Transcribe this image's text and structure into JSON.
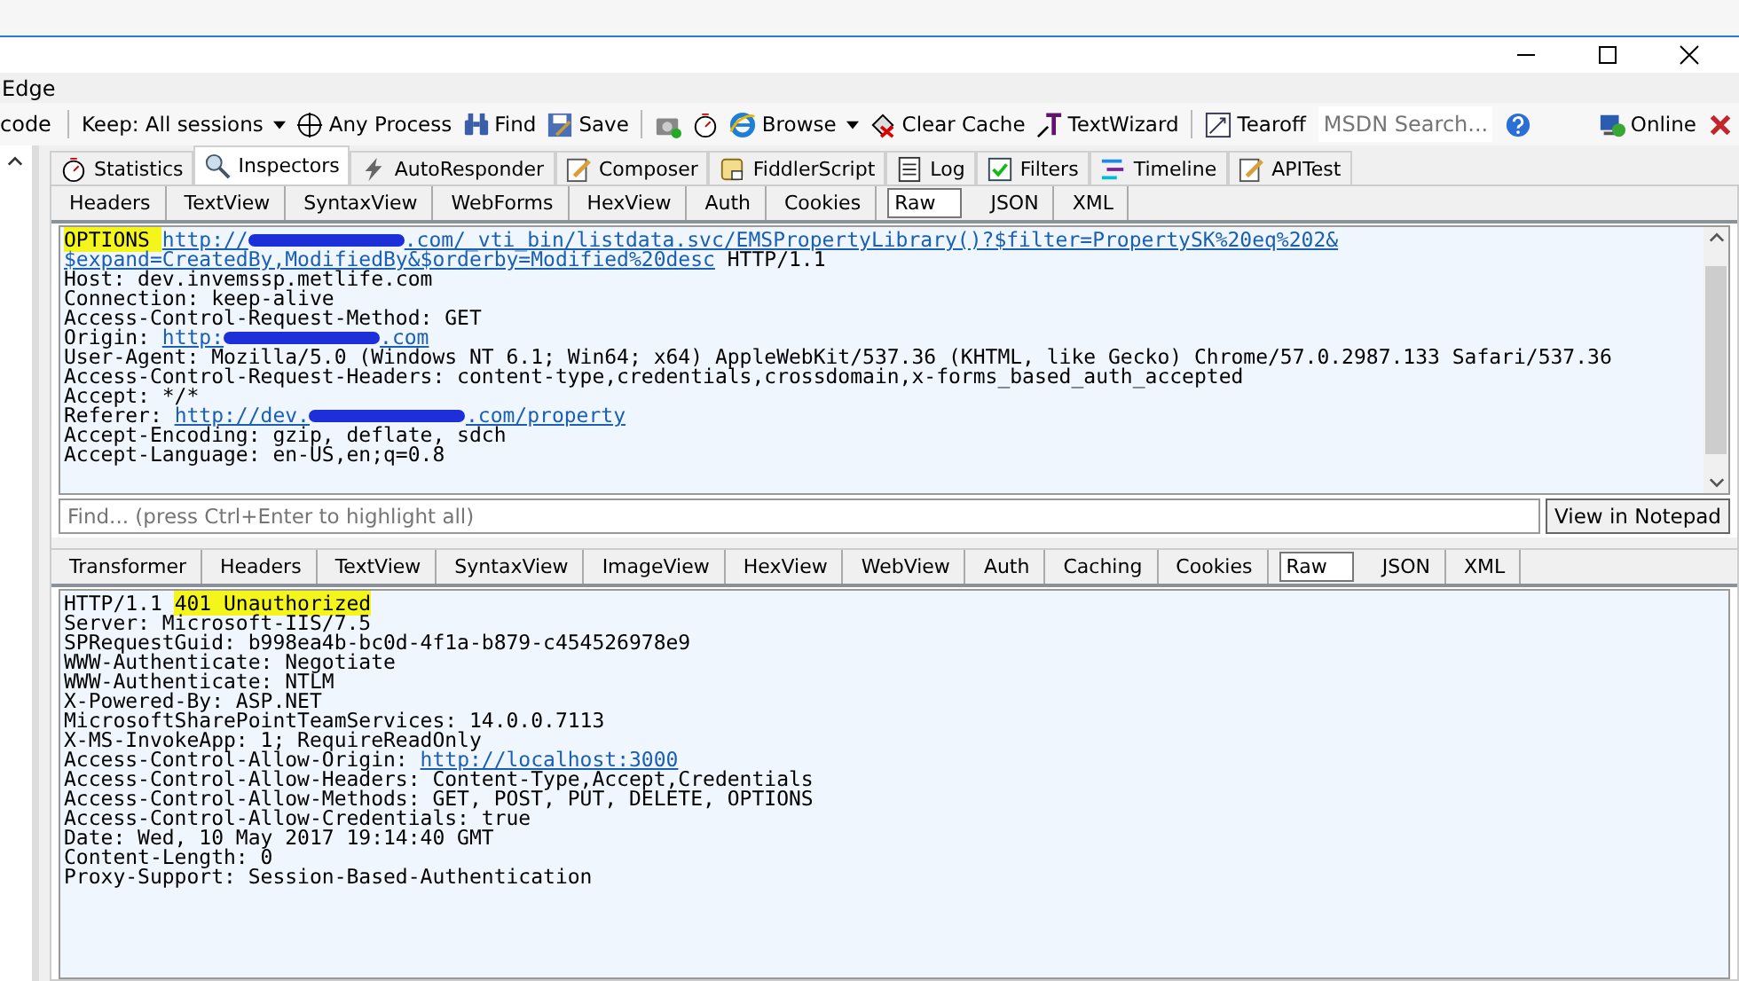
{
  "menu": {
    "items": [
      "Edge"
    ]
  },
  "toolbar": {
    "items": [
      {
        "kind": "text",
        "label": "code"
      },
      {
        "kind": "separator"
      },
      {
        "kind": "dropdown",
        "label": "Keep: All sessions"
      },
      {
        "kind": "button",
        "label": "Any Process"
      },
      {
        "kind": "button",
        "label": "Find"
      },
      {
        "kind": "button",
        "label": "Save"
      },
      {
        "kind": "separator"
      },
      {
        "kind": "button"
      },
      {
        "kind": "button"
      },
      {
        "kind": "dropdown",
        "label": "Browse"
      },
      {
        "kind": "button",
        "label": "Clear Cache"
      },
      {
        "kind": "button",
        "label": "TextWizard"
      },
      {
        "kind": "separator"
      },
      {
        "kind": "button",
        "label": "Tearoff"
      },
      {
        "kind": "search",
        "placeholder": "MSDN Search..."
      },
      {
        "kind": "button"
      },
      {
        "kind": "spacer"
      },
      {
        "kind": "button",
        "label": "Online"
      },
      {
        "kind": "button"
      }
    ]
  },
  "main_tabs": [
    {
      "label": "Statistics",
      "selected": false
    },
    {
      "label": "Inspectors",
      "selected": true
    },
    {
      "label": "AutoResponder",
      "selected": false
    },
    {
      "label": "Composer",
      "selected": false
    },
    {
      "label": "FiddlerScript",
      "selected": false
    },
    {
      "label": "Log",
      "selected": false
    },
    {
      "label": "Filters",
      "selected": false
    },
    {
      "label": "Timeline",
      "selected": false
    },
    {
      "label": "APITest",
      "selected": false
    }
  ],
  "request": {
    "tabs": [
      {
        "label": "Headers",
        "selected": false
      },
      {
        "label": "TextView",
        "selected": false
      },
      {
        "label": "SyntaxView",
        "selected": false
      },
      {
        "label": "WebForms",
        "selected": false
      },
      {
        "label": "HexView",
        "selected": false
      },
      {
        "label": "Auth",
        "selected": false
      },
      {
        "label": "Cookies",
        "selected": false
      },
      {
        "label": "Raw",
        "selected": true
      },
      {
        "label": "JSON",
        "selected": false
      },
      {
        "label": "XML",
        "selected": false
      }
    ],
    "lines": [
      [
        {
          "kind": "highlight",
          "text": "OPTIONS "
        },
        {
          "kind": "link",
          "text": "http://"
        },
        {
          "kind": "redacted"
        },
        {
          "kind": "link",
          "text": ".com/_vti_bin/listdata.svc/EMSPropertyLibrary()?$filter=PropertySK%20eq%202&"
        }
      ],
      [
        {
          "kind": "link",
          "text": "$expand=CreatedBy,ModifiedBy&$orderby=Modified%20desc"
        },
        {
          "kind": "text",
          "text": " HTTP/1.1"
        }
      ],
      [
        {
          "kind": "text",
          "text": "Host: dev.invemssp.metlife.com"
        }
      ],
      [
        {
          "kind": "text",
          "text": "Connection: keep-alive"
        }
      ],
      [
        {
          "kind": "text",
          "text": "Access-Control-Request-Method: GET"
        }
      ],
      [
        {
          "kind": "text",
          "text": "Origin: "
        },
        {
          "kind": "link",
          "text": "http:"
        },
        {
          "kind": "redacted"
        },
        {
          "kind": "link",
          "text": ".com"
        }
      ],
      [
        {
          "kind": "text",
          "text": "User-Agent: Mozilla/5.0 (Windows NT 6.1; Win64; x64) AppleWebKit/537.36 (KHTML, like Gecko) Chrome/57.0.2987.133 Safari/537.36"
        }
      ],
      [
        {
          "kind": "text",
          "text": "Access-Control-Request-Headers: content-type,credentials,crossdomain,x-forms_based_auth_accepted"
        }
      ],
      [
        {
          "kind": "text",
          "text": "Accept: */*"
        }
      ],
      [
        {
          "kind": "text",
          "text": "Referer: "
        },
        {
          "kind": "link",
          "text": "http://dev."
        },
        {
          "kind": "redacted"
        },
        {
          "kind": "link",
          "text": ".com/property"
        }
      ],
      [
        {
          "kind": "text",
          "text": "Accept-Encoding: gzip, deflate, sdch"
        }
      ],
      [
        {
          "kind": "text",
          "text": "Accept-Language: en-US,en;q=0.8"
        }
      ]
    ],
    "find": {
      "placeholder": "Find... (press Ctrl+Enter to highlight all)"
    },
    "notepad_button": "View in Notepad"
  },
  "response": {
    "tabs": [
      {
        "label": "Transformer",
        "selected": false
      },
      {
        "label": "Headers",
        "selected": false
      },
      {
        "label": "TextView",
        "selected": false
      },
      {
        "label": "SyntaxView",
        "selected": false
      },
      {
        "label": "ImageView",
        "selected": false
      },
      {
        "label": "HexView",
        "selected": false
      },
      {
        "label": "WebView",
        "selected": false
      },
      {
        "label": "Auth",
        "selected": false
      },
      {
        "label": "Caching",
        "selected": false
      },
      {
        "label": "Cookies",
        "selected": false
      },
      {
        "label": "Raw",
        "selected": true
      },
      {
        "label": "JSON",
        "selected": false
      },
      {
        "label": "XML",
        "selected": false
      }
    ],
    "lines": [
      [
        {
          "kind": "text",
          "text": "HTTP/1.1 "
        },
        {
          "kind": "highlight",
          "text": "401 Unauthorized"
        }
      ],
      [
        {
          "kind": "text",
          "text": "Server: Microsoft-IIS/7.5"
        }
      ],
      [
        {
          "kind": "text",
          "text": "SPRequestGuid: b998ea4b-bc0d-4f1a-b879-c454526978e9"
        }
      ],
      [
        {
          "kind": "text",
          "text": "WWW-Authenticate: Negotiate"
        }
      ],
      [
        {
          "kind": "text",
          "text": "WWW-Authenticate: NTLM"
        }
      ],
      [
        {
          "kind": "text",
          "text": "X-Powered-By: ASP.NET"
        }
      ],
      [
        {
          "kind": "text",
          "text": "MicrosoftSharePointTeamServices: 14.0.0.7113"
        }
      ],
      [
        {
          "kind": "text",
          "text": "X-MS-InvokeApp: 1; RequireReadOnly"
        }
      ],
      [
        {
          "kind": "text",
          "text": "Access-Control-Allow-Origin: "
        },
        {
          "kind": "link",
          "text": "http://localhost:3000"
        }
      ],
      [
        {
          "kind": "text",
          "text": "Access-Control-Allow-Headers: Content-Type,Accept,Credentials"
        }
      ],
      [
        {
          "kind": "text",
          "text": "Access-Control-Allow-Methods: GET, POST, PUT, DELETE, OPTIONS"
        }
      ],
      [
        {
          "kind": "text",
          "text": "Access-Control-Allow-Credentials: true"
        }
      ],
      [
        {
          "kind": "text",
          "text": "Date: Wed, 10 May 2017 19:14:40 GMT"
        }
      ],
      [
        {
          "kind": "text",
          "text": "Content-Length: 0"
        }
      ],
      [
        {
          "kind": "text",
          "text": "Proxy-Support: Session-Based-Authentication"
        }
      ]
    ]
  }
}
